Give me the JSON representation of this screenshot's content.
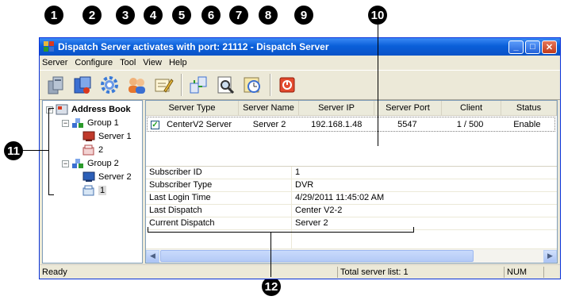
{
  "callouts": [
    "1",
    "2",
    "3",
    "4",
    "5",
    "6",
    "7",
    "8",
    "9",
    "10",
    "11",
    "12"
  ],
  "window": {
    "title": "Dispatch Server activates with port: 21112 - Dispatch Server",
    "controls": {
      "minimize": "_",
      "maximize": "□",
      "close": "✕"
    }
  },
  "menu": [
    "Server",
    "Configure",
    "Tool",
    "View",
    "Help"
  ],
  "toolbar": [
    {
      "name": "server-icon",
      "color": "#8a9bb0"
    },
    {
      "name": "configure-icon",
      "color": "#3b6fd1"
    },
    {
      "name": "settings-gear-icon",
      "color": "#3a7ad8"
    },
    {
      "name": "users-icon",
      "color": "#e6772e"
    },
    {
      "name": "edit-icon",
      "color": "#e5b73b"
    },
    {
      "name": "network-icon",
      "color": "#3b6fd1"
    },
    {
      "name": "search-icon",
      "color": "#666666"
    },
    {
      "name": "schedule-icon",
      "color": "#e5b73b"
    },
    {
      "name": "power-icon",
      "color": "#d9381e"
    }
  ],
  "tree": {
    "root": "Address Book",
    "group1": "Group 1",
    "g1_server": "Server 1",
    "g1_client": "2",
    "group2": "Group 2",
    "g2_server": "Server 2",
    "g2_client": "1"
  },
  "table": {
    "columns": [
      "Server Type",
      "Server Name",
      "Server IP",
      "Server Port",
      "Client",
      "Status"
    ],
    "rows": [
      {
        "checked": "✓",
        "type": "CenterV2 Server",
        "name": "Server 2",
        "ip": "192.168.1.48",
        "port": "5547",
        "client": "1 / 500",
        "status": "Enable"
      }
    ]
  },
  "details": [
    {
      "label": "Subscriber ID",
      "value": "1"
    },
    {
      "label": "Subscriber Type",
      "value": "DVR"
    },
    {
      "label": "Last Login Time",
      "value": "4/29/2011 11:45:02 AM"
    },
    {
      "label": "Last Dispatch",
      "value": "Center V2-2"
    },
    {
      "label": "Current Dispatch",
      "value": "Server 2"
    }
  ],
  "status": {
    "left": "Ready",
    "total": "Total server list: 1",
    "num": "NUM"
  },
  "scroll": {
    "left_arrow": "◀",
    "right_arrow": "▶"
  }
}
